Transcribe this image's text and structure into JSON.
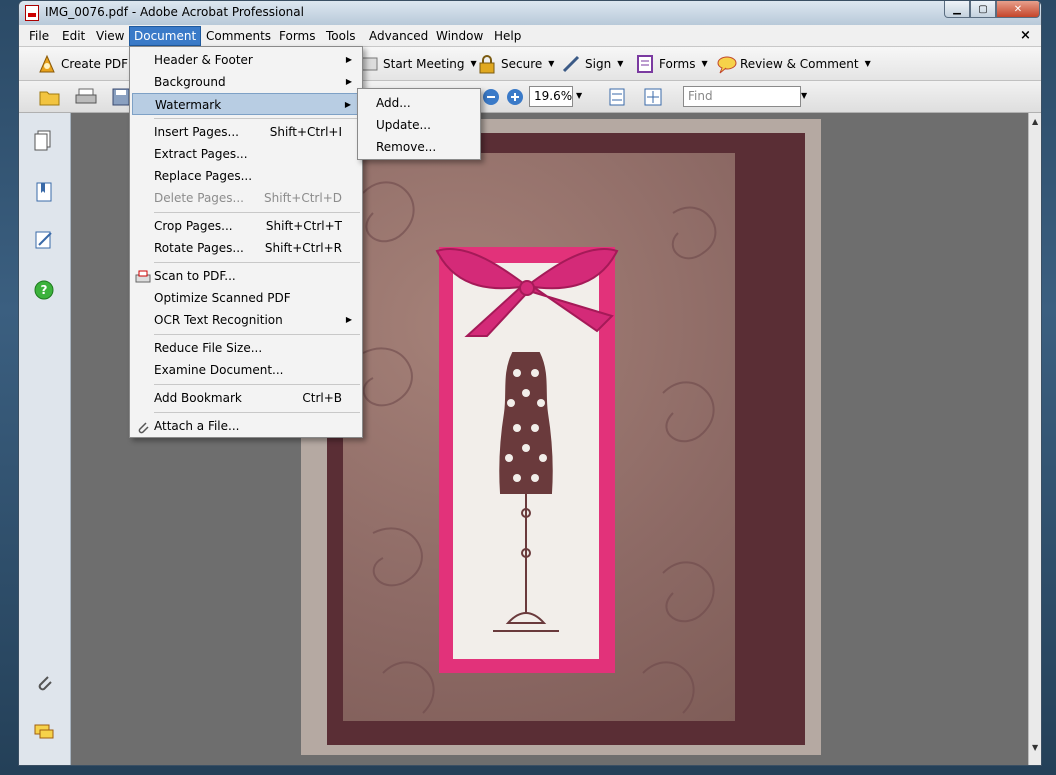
{
  "window": {
    "title": "IMG_0076.pdf - Adobe Acrobat Professional"
  },
  "menubar": {
    "items": [
      "File",
      "Edit",
      "View",
      "Document",
      "Comments",
      "Forms",
      "Tools",
      "Advanced",
      "Window",
      "Help"
    ],
    "close": "×"
  },
  "toolbar": {
    "create_pdf": "Create PDF",
    "start_meeting": "Start Meeting",
    "secure": "Secure",
    "sign": "Sign",
    "forms": "Forms",
    "review_comment": "Review & Comment",
    "zoom_value": "19.6%",
    "find_placeholder": "Find"
  },
  "document_menu": {
    "items": [
      {
        "label": "Header & Footer",
        "submenu": true
      },
      {
        "label": "Background",
        "submenu": true
      },
      {
        "label": "Watermark",
        "submenu": true,
        "highlighted": true
      },
      {
        "label": "Insert Pages...",
        "shortcut": "Shift+Ctrl+I"
      },
      {
        "label": "Extract Pages..."
      },
      {
        "label": "Replace Pages..."
      },
      {
        "label": "Delete Pages...",
        "shortcut": "Shift+Ctrl+D",
        "disabled": true
      },
      {
        "label": "Crop Pages...",
        "shortcut": "Shift+Ctrl+T"
      },
      {
        "label": "Rotate Pages...",
        "shortcut": "Shift+Ctrl+R"
      },
      {
        "label": "Scan to PDF..."
      },
      {
        "label": "Optimize Scanned PDF"
      },
      {
        "label": "OCR Text Recognition",
        "submenu": true
      },
      {
        "label": "Reduce File Size..."
      },
      {
        "label": "Examine Document..."
      },
      {
        "label": "Add Bookmark",
        "shortcut": "Ctrl+B"
      },
      {
        "label": "Attach a File..."
      }
    ]
  },
  "watermark_submenu": {
    "items": [
      "Add...",
      "Update...",
      "Remove..."
    ]
  },
  "colors": {
    "menu_active": "#3a7ac8",
    "highlight": "#b8cde3",
    "card_pink": "#e2327a",
    "card_brown": "#5a2e35"
  }
}
